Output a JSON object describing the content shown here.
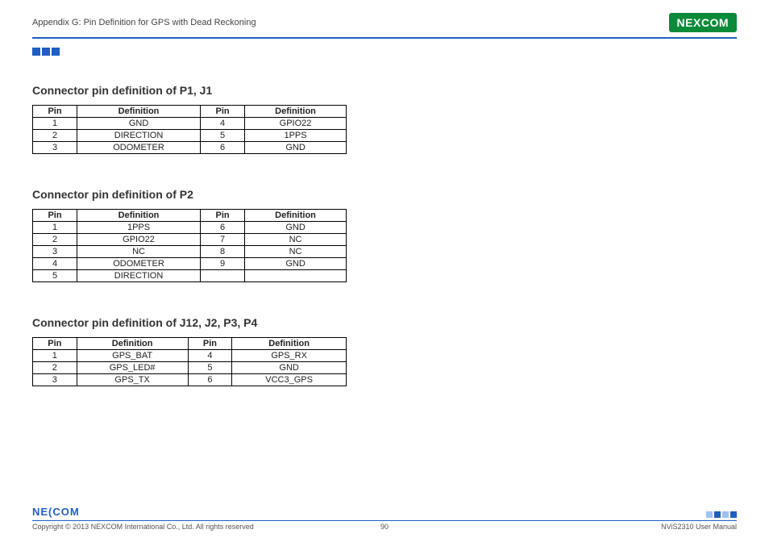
{
  "header": {
    "breadcrumb": "Appendix G: Pin Definition for GPS with Dead Reckoning",
    "brand": "NEXCOM"
  },
  "sections": {
    "s1": {
      "title": "Connector pin definition of P1, J1",
      "headers": [
        "Pin",
        "Definition",
        "Pin",
        "Definition"
      ],
      "rows": [
        [
          "1",
          "GND",
          "4",
          "GPIO22"
        ],
        [
          "2",
          "DIRECTION",
          "5",
          "1PPS"
        ],
        [
          "3",
          "ODOMETER",
          "6",
          "GND"
        ]
      ]
    },
    "s2": {
      "title": "Connector pin definition of P2",
      "headers": [
        "Pin",
        "Definition",
        "Pin",
        "Definition"
      ],
      "rows": [
        [
          "1",
          "1PPS",
          "6",
          "GND"
        ],
        [
          "2",
          "GPIO22",
          "7",
          "NC"
        ],
        [
          "3",
          "NC",
          "8",
          "NC"
        ],
        [
          "4",
          "ODOMETER",
          "9",
          "GND"
        ],
        [
          "5",
          "DIRECTION",
          "",
          ""
        ]
      ]
    },
    "s3": {
      "title": "Connector pin definition of J12, J2, P3, P4",
      "headers": [
        "Pin",
        "Definition",
        "Pin",
        "Definition"
      ],
      "rows": [
        [
          "1",
          "GPS_BAT",
          "4",
          "GPS_RX"
        ],
        [
          "2",
          "GPS_LED#",
          "5",
          "GND"
        ],
        [
          "3",
          "GPS_TX",
          "6",
          "VCC3_GPS"
        ]
      ]
    }
  },
  "footer": {
    "brand": "NE(COM",
    "copyright": "Copyright © 2013 NEXCOM International Co., Ltd. All rights reserved",
    "page": "90",
    "manual": "NViS2310 User Manual"
  }
}
